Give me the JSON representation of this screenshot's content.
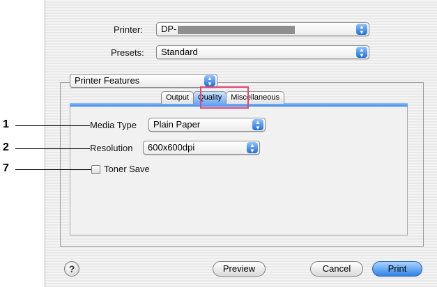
{
  "printer": {
    "label": "Printer:",
    "value": "DP-"
  },
  "presets": {
    "label": "Presets:",
    "value": "Standard"
  },
  "feature_menu": {
    "value": "Printer Features"
  },
  "tabs": [
    {
      "label": "Output"
    },
    {
      "label": "Quality"
    },
    {
      "label": "Miscellaneous"
    }
  ],
  "quality": {
    "media_type_label": "Media Type",
    "media_type_value": "Plain Paper",
    "resolution_label": "Resolution",
    "resolution_value": "600x600dpi",
    "toner_save_label": "Toner Save"
  },
  "callouts": [
    "1",
    "2",
    "7"
  ],
  "buttons": {
    "help": "?",
    "preview": "Preview",
    "cancel": "Cancel",
    "print": "Print"
  },
  "colors": {
    "highlight": "#e0457b",
    "accent": "#3b88e8"
  }
}
